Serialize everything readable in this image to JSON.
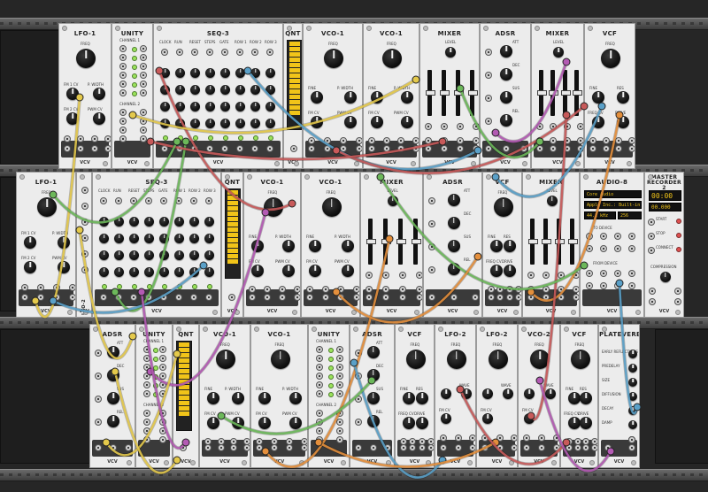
{
  "rack": {
    "rows": [
      {
        "modules": [
          {
            "name": "LFO-1",
            "kind": "lfo",
            "labels": [
              "FREQ",
              "FM 1 CV",
              "P. WIDTH",
              "FM 2 CV",
              "PWM CV"
            ]
          },
          {
            "name": "UNITY",
            "kind": "unity",
            "labels": [
              "CHANNEL 1",
              "CHANNEL 2"
            ]
          },
          {
            "name": "SEQ-3",
            "kind": "seq",
            "labels": [
              "CLOCK",
              "RUN",
              "RESET",
              "STEPS",
              "GATE",
              "ROW 1",
              "ROW 2",
              "ROW 3"
            ]
          },
          {
            "name": "QNT",
            "kind": "qnt",
            "labels": []
          },
          {
            "name": "VCO-1",
            "kind": "vco",
            "labels": [
              "FREQ",
              "FINE",
              "P. WIDTH",
              "FM CV",
              "PWM CV"
            ]
          },
          {
            "name": "VCO-1",
            "kind": "vco",
            "labels": [
              "FREQ",
              "FINE",
              "P. WIDTH",
              "FM CV",
              "PWM CV"
            ]
          },
          {
            "name": "MIXER",
            "kind": "mixer",
            "labels": [
              "LEVEL"
            ]
          },
          {
            "name": "ADSR",
            "kind": "adsr",
            "labels": [
              "ATT",
              "DEC",
              "SUS",
              "REL"
            ]
          },
          {
            "name": "MIXER",
            "kind": "mixer",
            "labels": [
              "LEVEL"
            ]
          },
          {
            "name": "VCF",
            "kind": "vcf",
            "labels": [
              "FREQ",
              "FINE",
              "RES",
              "FREQ CV",
              "DRIVE"
            ]
          }
        ]
      },
      {
        "modules": [
          {
            "name": "LFO-1",
            "kind": "lfo",
            "labels": [
              "FREQ",
              "FM 1 CV",
              "P. WIDTH",
              "FM 2 CV",
              "PWM CV"
            ]
          },
          {
            "name": "LFO-2",
            "kind": "thin",
            "labels": []
          },
          {
            "name": "SEQ-3",
            "kind": "seq",
            "labels": [
              "CLOCK",
              "RUN",
              "RESET",
              "STEPS",
              "GATE",
              "ROW 1",
              "ROW 2",
              "ROW 3"
            ]
          },
          {
            "name": "QNT",
            "kind": "qnt",
            "labels": []
          },
          {
            "name": "VCO-1",
            "kind": "vco",
            "labels": [
              "FREQ",
              "FINE",
              "P. WIDTH",
              "FM CV",
              "PWM CV"
            ]
          },
          {
            "name": "VCO-1",
            "kind": "vco",
            "labels": [
              "FREQ",
              "FINE",
              "P. WIDTH",
              "FM CV",
              "PWM CV"
            ]
          },
          {
            "name": "MIXER",
            "kind": "mixer",
            "labels": [
              "LEVEL"
            ]
          },
          {
            "name": "ADSR",
            "kind": "adsr",
            "labels": [
              "ATT",
              "DEC",
              "SUS",
              "REL"
            ]
          },
          {
            "name": "VCF",
            "kind": "vcf",
            "labels": [
              "FREQ",
              "FINE",
              "RES",
              "FREQ CV",
              "DRIVE"
            ]
          },
          {
            "name": "MIXER",
            "kind": "mixer",
            "labels": [
              "LEVEL"
            ]
          },
          {
            "name": "AUDIO-8",
            "kind": "audio",
            "labels": [
              "TO DEVICE",
              "FROM DEVICE"
            ]
          },
          {
            "name": "MASTER RECORDER 2",
            "kind": "recorder",
            "labels": [
              "START",
              "STOP",
              "CONNECT",
              "COMPRESSION"
            ]
          }
        ]
      },
      {
        "modules": [
          {
            "name": "ADSR",
            "kind": "adsr",
            "labels": [
              "ATT",
              "DEC",
              "SUS",
              "REL"
            ]
          },
          {
            "name": "UNITY",
            "kind": "unity",
            "labels": [
              "CHANNEL 1",
              "CHANNEL 2"
            ]
          },
          {
            "name": "QNT",
            "kind": "qnt",
            "labels": []
          },
          {
            "name": "VCO-1",
            "kind": "vco",
            "labels": [
              "FREQ",
              "FINE",
              "P. WIDTH",
              "FM CV",
              "PWM CV"
            ]
          },
          {
            "name": "VCO-1",
            "kind": "vco",
            "labels": [
              "FREQ",
              "FINE",
              "P. WIDTH",
              "FM CV",
              "PWM CV"
            ]
          },
          {
            "name": "UNITY",
            "kind": "unity",
            "labels": [
              "CHANNEL 1",
              "CHANNEL 2"
            ]
          },
          {
            "name": "ADSR",
            "kind": "adsr",
            "labels": [
              "ATT",
              "DEC",
              "SUS",
              "REL"
            ]
          },
          {
            "name": "VCF",
            "kind": "vcf",
            "labels": [
              "FREQ",
              "FINE",
              "RES",
              "FREQ CV",
              "DRIVE"
            ]
          },
          {
            "name": "LFO-2",
            "kind": "lfo2",
            "labels": [
              "FREQ",
              "WAVE",
              "FM CV"
            ]
          },
          {
            "name": "LFO-2",
            "kind": "lfo2",
            "labels": [
              "FREQ",
              "WAVE",
              "FM CV"
            ]
          },
          {
            "name": "VCO-2",
            "kind": "lfo2",
            "labels": [
              "FREQ",
              "WAVE",
              "FM CV"
            ]
          },
          {
            "name": "VCF",
            "kind": "vcf",
            "labels": [
              "FREQ",
              "FINE",
              "RES",
              "FREQ CV",
              "DRIVE"
            ]
          },
          {
            "name": "PLATEVERB",
            "kind": "plateverb",
            "labels": [
              "EARLY REFLECTIONS",
              "PREDELAY",
              "SIZE",
              "DIFFUSION",
              "DECAY",
              "DAMP"
            ]
          }
        ]
      }
    ],
    "brand": "VCV"
  },
  "audio_device": {
    "device": "Core Audio",
    "input": "Apple Inc.: Built-in",
    "rate": "44.1 kHz",
    "block": "256"
  },
  "recorder": {
    "time": "00:00",
    "level": "00.000"
  },
  "colors": {
    "panel": "#ececec",
    "rack": "#262626",
    "meter": "#f1c419",
    "cables": [
      "#c85a5a",
      "#e4c94b",
      "#5aa0c8",
      "#6cb85a",
      "#b35ab3",
      "#e48f3c"
    ]
  }
}
